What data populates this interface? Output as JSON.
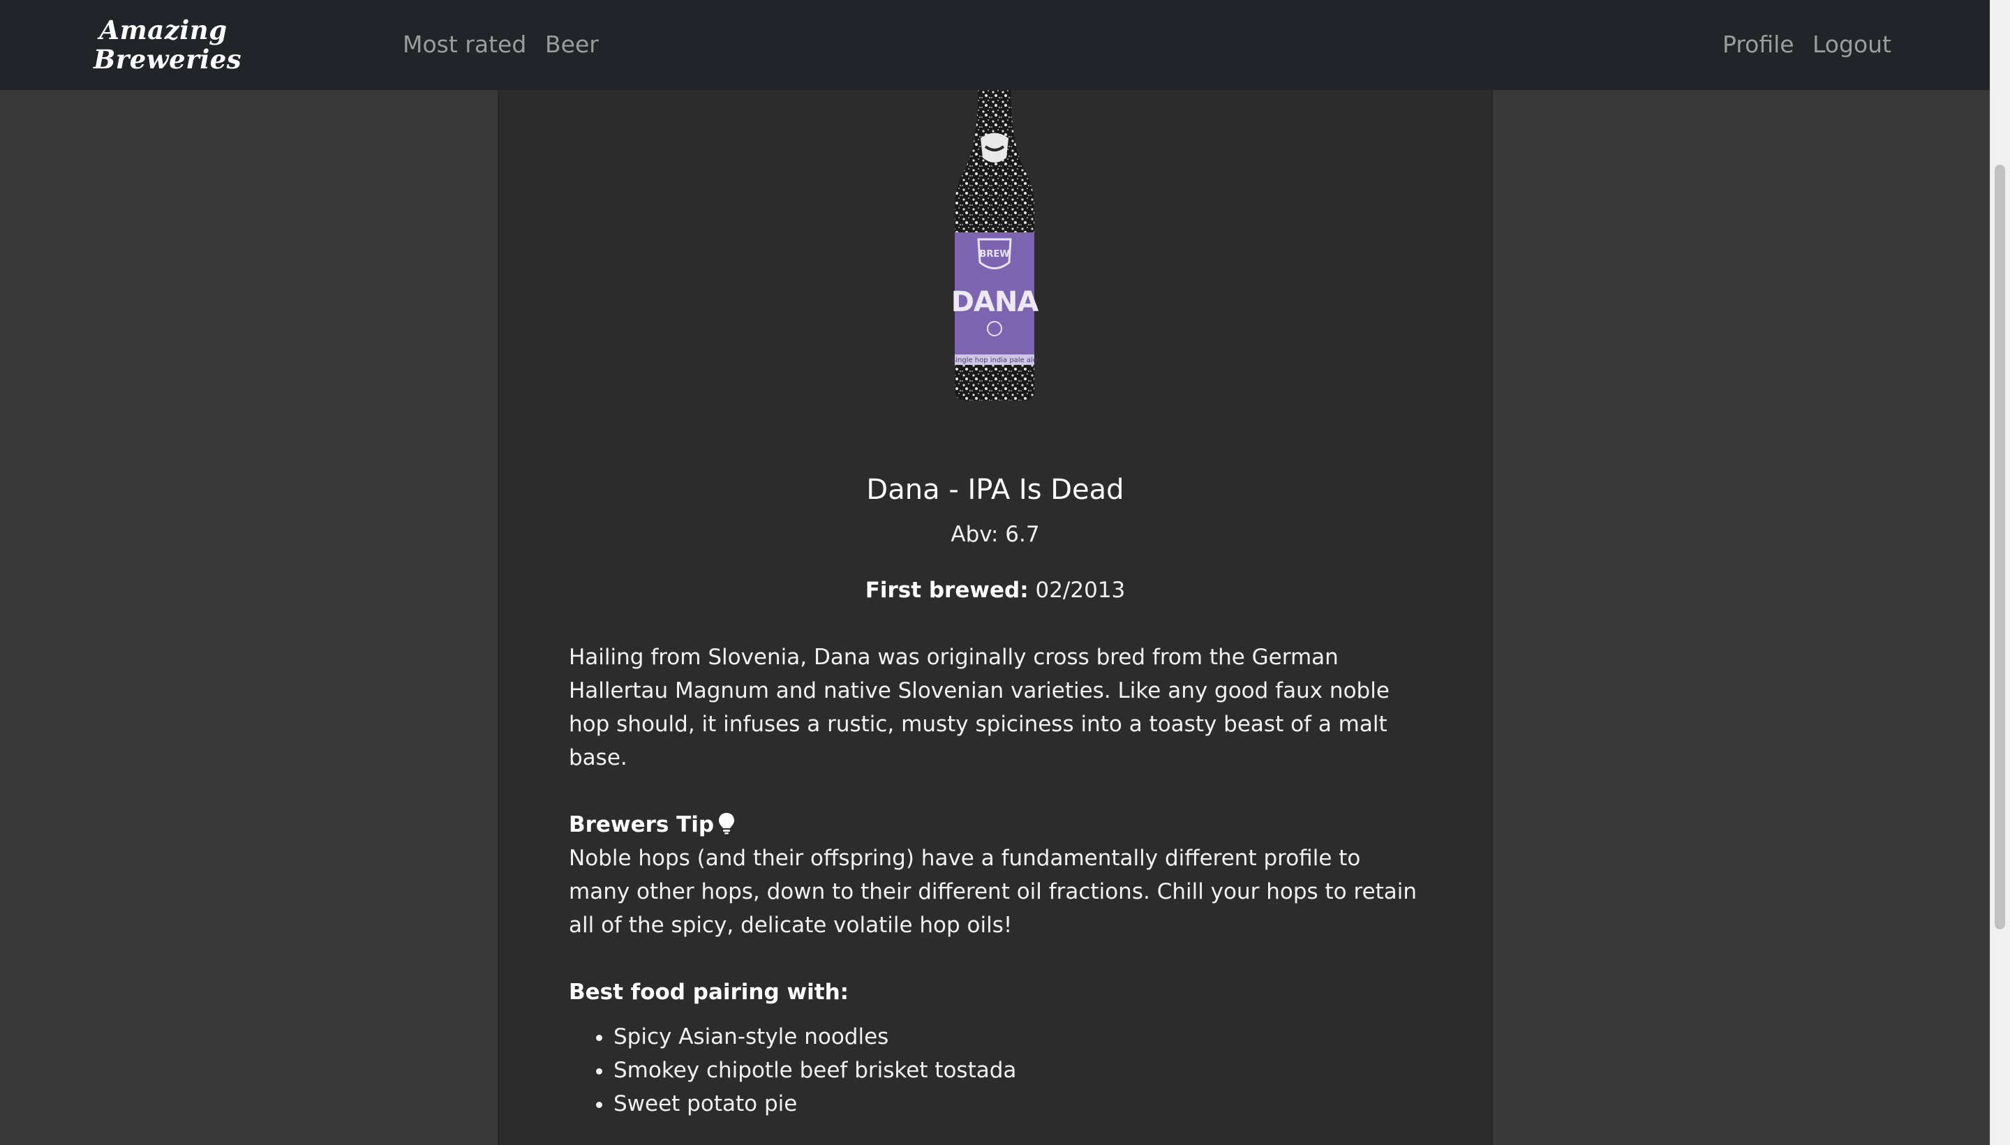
{
  "navbar": {
    "brand_line1": "Amazing",
    "brand_line2": "Breweries",
    "links": {
      "most_rated": "Most rated",
      "beer": "Beer",
      "profile": "Profile",
      "logout": "Logout"
    }
  },
  "beer": {
    "image_alt": "Dana - IPA Is Dead bottle",
    "label_text": "DANA",
    "name": "Dana - IPA Is Dead",
    "abv_text": "Abv: 6.7",
    "first_brewed_label": "First brewed:",
    "first_brewed_value": "02/2013",
    "description": "Hailing from Slovenia, Dana was originally cross bred from the German Hallertau Magnum and native Slovenian varieties. Like any good faux noble hop should, it infuses a rustic, musty spiciness into a toasty beast of a malt base.",
    "brewers_tip_label": "Brewers Tip",
    "brewers_tip": "Noble hops (and their offspring) have a fundamentally different profile to many other hops, down to their different oil fractions. Chill your hops to retain all of the spicy, delicate volatile hop oils!",
    "food_pairing_label": "Best food pairing with:",
    "food_pairing": [
      "Spicy Asian-style noodles",
      "Smokey chipotle beef brisket tostada",
      "Sweet potato pie"
    ]
  },
  "colors": {
    "navbar_bg": "#212529",
    "page_bg": "#393939",
    "content_bg": "#2c2c2c",
    "label_purple": "#7d64b0"
  }
}
